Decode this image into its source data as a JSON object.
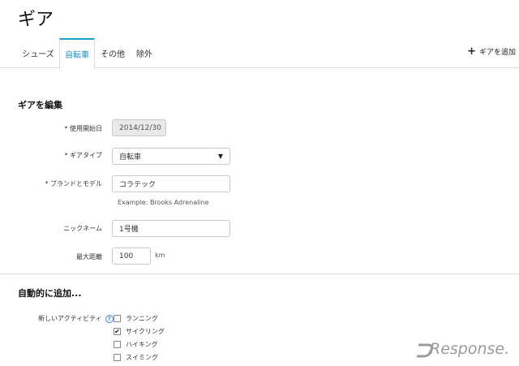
{
  "page": {
    "title": "ギア"
  },
  "tabs": [
    {
      "label": "シューズ",
      "active": false
    },
    {
      "label": "自転車",
      "active": true
    },
    {
      "label": "その他",
      "active": false
    },
    {
      "label": "除外",
      "active": false
    }
  ],
  "header": {
    "add_gear_label": "ギアを追加",
    "add_gear_icon": "plus-icon"
  },
  "edit_section": {
    "title": "ギアを編集",
    "start_date": {
      "label": "* 使用開始日",
      "value": "2014/12/30"
    },
    "gear_type": {
      "label": "* ギアタイプ",
      "value": "自転車"
    },
    "brand_model": {
      "label": "* ブランドとモデル",
      "value": "コラテック",
      "hint": "Example: Brooks Adrenaline"
    },
    "nickname": {
      "label": "ニックネーム",
      "value": "1号機"
    },
    "max_distance": {
      "label": "最大距離",
      "value": "100",
      "unit": "km"
    }
  },
  "auto_section": {
    "title": "自動的に追加...",
    "activities_label": "新しいアクティビティ",
    "help_icon": "question-circle-icon",
    "options": [
      {
        "label": "ランニング",
        "checked": false
      },
      {
        "label": "サイクリング",
        "checked": true
      },
      {
        "label": "ハイキング",
        "checked": false
      },
      {
        "label": "スイミング",
        "checked": false
      }
    ]
  },
  "watermark": {
    "text": "Response."
  },
  "colors": {
    "accent": "#1aa0d2",
    "border": "#dcdcdc",
    "help": "#3a8ad3"
  }
}
